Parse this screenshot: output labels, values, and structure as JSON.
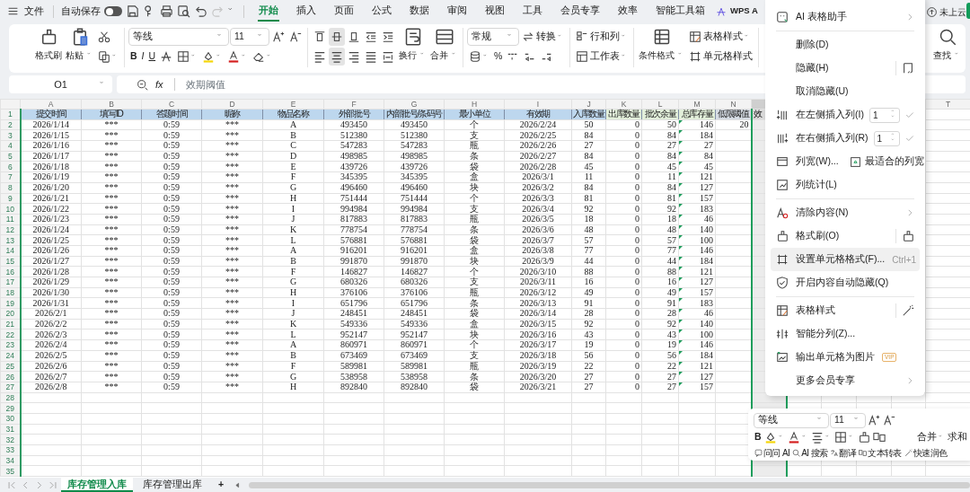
{
  "file_menu": "文件",
  "autosave": {
    "label": "自动保存",
    "on": false
  },
  "redo": {
    "disabled": true
  },
  "tabs": [
    {
      "label": "开始",
      "selected": true
    },
    {
      "label": "插入",
      "selected": false
    },
    {
      "label": "页面",
      "selected": false
    },
    {
      "label": "公式",
      "selected": false
    },
    {
      "label": "数据",
      "selected": false
    },
    {
      "label": "审阅",
      "selected": false
    },
    {
      "label": "视图",
      "selected": false
    },
    {
      "label": "工具",
      "selected": false
    },
    {
      "label": "会员专享",
      "selected": false
    },
    {
      "label": "效率",
      "selected": false
    },
    {
      "label": "智能工具箱",
      "selected": false
    }
  ],
  "wps_label": "WPS A",
  "cloud_status": "未上云",
  "ribbon": {
    "format_painter": "格式刷",
    "paste": "粘贴",
    "font": "等线",
    "font_size": "11",
    "bold": "B",
    "italic": "I",
    "underline": "U",
    "wrap": "换行",
    "merge": "合并",
    "number_format": "常规",
    "convert": "转换",
    "percent": "%",
    "rows_cols": "行和列",
    "worksheet": "工作表",
    "conditional": "条件格式",
    "table_style": "表格样式",
    "cell_style": "单元格样式",
    "find": "查找",
    "valign": [
      {
        "selected": false
      },
      {
        "selected": true
      },
      {
        "selected": false
      }
    ],
    "halign": [
      {
        "selected": false
      },
      {
        "selected": true
      },
      {
        "selected": false
      },
      {
        "selected": false
      }
    ]
  },
  "name_box": "O1",
  "fx": "fx",
  "formula": "效期阈值",
  "columns": [
    {
      "letter": "A",
      "selected": false
    },
    {
      "letter": "B",
      "selected": false
    },
    {
      "letter": "C",
      "selected": false
    },
    {
      "letter": "D",
      "selected": false
    },
    {
      "letter": "E",
      "selected": false
    },
    {
      "letter": "F",
      "selected": false
    },
    {
      "letter": "G",
      "selected": false
    },
    {
      "letter": "H",
      "selected": false
    },
    {
      "letter": "I",
      "selected": false
    },
    {
      "letter": "J",
      "selected": false
    },
    {
      "letter": "K",
      "selected": false
    },
    {
      "letter": "L",
      "selected": false
    },
    {
      "letter": "M",
      "selected": false
    },
    {
      "letter": "N",
      "selected": false
    },
    {
      "selected": true
    },
    {
      "letter": "T",
      "selected": false
    }
  ],
  "row_numbers": [
    "1",
    "2",
    "3",
    "4",
    "5",
    "6",
    "7",
    "8",
    "9",
    "10",
    "11",
    "12",
    "13",
    "14",
    "15",
    "16",
    "17",
    "18",
    "19",
    "20",
    "21",
    "22",
    "23",
    "24",
    "25",
    "26",
    "27",
    "28",
    "29",
    "30",
    "31",
    "32",
    "33",
    "34",
    "35"
  ],
  "header_row": [
    {
      "text": "提交时间",
      "color": "#bdd7ee"
    },
    {
      "text": "填写ID",
      "color": "#bdd7ee"
    },
    {
      "text": "答题时间",
      "color": "#bdd7ee"
    },
    {
      "text": "昵称",
      "color": "#bdd7ee"
    },
    {
      "text": "物品名称",
      "color": "#bdd7ee"
    },
    {
      "text": "外部批号",
      "color": "#bdd7ee"
    },
    {
      "text": "内部批号/条码号",
      "color": "#bdd7ee"
    },
    {
      "text": "最小单位",
      "color": "#bdd7ee"
    },
    {
      "text": "有效期",
      "color": "#bdd7ee"
    },
    {
      "text": "入库数量",
      "color": "#bdd7ee"
    },
    {
      "text": "出库数量",
      "color": "#e2efda"
    },
    {
      "text": "批次余量",
      "color": "#e2efda"
    },
    {
      "text": "总库存量",
      "color": "#e2efda"
    },
    {
      "text": "低限阈值",
      "color": "#d6dce4"
    },
    {
      "text": "效",
      "color": "#d9d9d9"
    }
  ],
  "rows": [
    {
      "cells": [
        "2026/1/14",
        "***",
        "0:59",
        "***",
        "A",
        "493450",
        "493450",
        "个",
        "2026/2/24",
        "50",
        "0",
        "50",
        "146",
        "20"
      ],
      "flagged": true
    },
    {
      "cells": [
        "2026/1/15",
        "***",
        "0:59",
        "***",
        "B",
        "512380",
        "512380",
        "支",
        "2026/2/25",
        "84",
        "0",
        "84",
        "184"
      ],
      "flagged": true
    },
    {
      "cells": [
        "2026/1/16",
        "***",
        "0:59",
        "***",
        "C",
        "547283",
        "547283",
        "瓶",
        "2026/2/26",
        "27",
        "0",
        "27",
        "27"
      ],
      "flagged": true
    },
    {
      "cells": [
        "2026/1/17",
        "***",
        "0:59",
        "***",
        "D",
        "498985",
        "498985",
        "条",
        "2026/2/27",
        "84",
        "0",
        "84",
        "84"
      ],
      "flagged": true
    },
    {
      "cells": [
        "2026/1/18",
        "***",
        "0:59",
        "***",
        "E",
        "439726",
        "439726",
        "袋",
        "2026/2/28",
        "45",
        "0",
        "45",
        "45"
      ],
      "flagged": true
    },
    {
      "cells": [
        "2026/1/19",
        "***",
        "0:59",
        "***",
        "F",
        "345395",
        "345395",
        "盒",
        "2026/3/1",
        "11",
        "0",
        "11",
        "121"
      ],
      "flagged": true
    },
    {
      "cells": [
        "2026/1/20",
        "***",
        "0:59",
        "***",
        "G",
        "496460",
        "496460",
        "块",
        "2026/3/2",
        "84",
        "0",
        "84",
        "127"
      ],
      "flagged": true
    },
    {
      "cells": [
        "2026/1/21",
        "***",
        "0:59",
        "***",
        "H",
        "751444",
        "751444",
        "个",
        "2026/3/3",
        "81",
        "0",
        "81",
        "157"
      ],
      "flagged": true
    },
    {
      "cells": [
        "2026/1/22",
        "***",
        "0:59",
        "***",
        "I",
        "994984",
        "994984",
        "支",
        "2026/3/4",
        "92",
        "0",
        "92",
        "183"
      ],
      "flagged": true
    },
    {
      "cells": [
        "2026/1/23",
        "***",
        "0:59",
        "***",
        "J",
        "817883",
        "817883",
        "瓶",
        "2026/3/5",
        "18",
        "0",
        "18",
        "46"
      ],
      "flagged": true
    },
    {
      "cells": [
        "2026/1/24",
        "***",
        "0:59",
        "***",
        "K",
        "778754",
        "778754",
        "条",
        "2026/3/6",
        "48",
        "0",
        "48",
        "140"
      ],
      "flagged": true
    },
    {
      "cells": [
        "2026/1/25",
        "***",
        "0:59",
        "***",
        "L",
        "576881",
        "576881",
        "袋",
        "2026/3/7",
        "57",
        "0",
        "57",
        "100"
      ],
      "flagged": true
    },
    {
      "cells": [
        "2026/1/26",
        "***",
        "0:59",
        "***",
        "A",
        "916201",
        "916201",
        "盒",
        "2026/3/8",
        "77",
        "0",
        "77",
        "146"
      ],
      "flagged": true
    },
    {
      "cells": [
        "2026/1/27",
        "***",
        "0:59",
        "***",
        "B",
        "991870",
        "991870",
        "块",
        "2026/3/9",
        "44",
        "0",
        "44",
        "184"
      ],
      "flagged": true
    },
    {
      "cells": [
        "2026/1/28",
        "***",
        "0:59",
        "***",
        "F",
        "146827",
        "146827",
        "个",
        "2026/3/10",
        "88",
        "0",
        "88",
        "121"
      ],
      "flagged": true
    },
    {
      "cells": [
        "2026/1/29",
        "***",
        "0:59",
        "***",
        "G",
        "680326",
        "680326",
        "支",
        "2026/3/11",
        "16",
        "0",
        "16",
        "127"
      ],
      "flagged": true
    },
    {
      "cells": [
        "2026/1/30",
        "***",
        "0:59",
        "***",
        "H",
        "376106",
        "376106",
        "瓶",
        "2026/3/12",
        "49",
        "0",
        "49",
        "157"
      ],
      "flagged": true
    },
    {
      "cells": [
        "2026/1/31",
        "***",
        "0:59",
        "***",
        "I",
        "651796",
        "651796",
        "条",
        "2026/3/13",
        "91",
        "0",
        "91",
        "183"
      ],
      "flagged": true
    },
    {
      "cells": [
        "2026/2/1",
        "***",
        "0:59",
        "***",
        "J",
        "248451",
        "248451",
        "袋",
        "2026/3/14",
        "28",
        "0",
        "28",
        "46"
      ],
      "flagged": true
    },
    {
      "cells": [
        "2026/2/2",
        "***",
        "0:59",
        "***",
        "K",
        "549336",
        "549336",
        "盒",
        "2026/3/15",
        "92",
        "0",
        "92",
        "140"
      ],
      "flagged": true
    },
    {
      "cells": [
        "2026/2/3",
        "***",
        "0:59",
        "***",
        "L",
        "952147",
        "952147",
        "块",
        "2026/3/16",
        "43",
        "0",
        "43",
        "100"
      ],
      "flagged": true
    },
    {
      "cells": [
        "2026/2/4",
        "***",
        "0:59",
        "***",
        "A",
        "860971",
        "860971",
        "个",
        "2026/3/17",
        "19",
        "0",
        "19",
        "146"
      ],
      "flagged": true
    },
    {
      "cells": [
        "2026/2/5",
        "***",
        "0:59",
        "***",
        "B",
        "673469",
        "673469",
        "支",
        "2026/3/18",
        "56",
        "0",
        "56",
        "184"
      ],
      "flagged": true
    },
    {
      "cells": [
        "2026/2/6",
        "***",
        "0:59",
        "***",
        "F",
        "589981",
        "589981",
        "瓶",
        "2026/3/19",
        "22",
        "0",
        "22",
        "121"
      ],
      "flagged": true
    },
    {
      "cells": [
        "2026/2/7",
        "***",
        "0:59",
        "***",
        "G",
        "538958",
        "538958",
        "条",
        "2026/3/20",
        "27",
        "0",
        "27",
        "127"
      ],
      "flagged": true
    },
    {
      "cells": [
        "2026/2/8",
        "***",
        "0:59",
        "***",
        "H",
        "892840",
        "892840",
        "袋",
        "2026/3/21",
        "27",
        "0",
        "27",
        "157"
      ],
      "flagged": true
    }
  ],
  "context_menu": [
    {
      "kind": "item",
      "label": "AI 表格助手",
      "submenu": true,
      "highlighted": false
    },
    {
      "kind": "divider"
    },
    {
      "kind": "item",
      "label": "删除(D)",
      "highlighted": false
    },
    {
      "kind": "item",
      "label": "隐藏(H)",
      "side_icon": true,
      "highlighted": false
    },
    {
      "kind": "item",
      "label": "取消隐藏(U)",
      "highlighted": false
    },
    {
      "kind": "item",
      "label": "在左侧插入列(I)",
      "spin_value": "1",
      "highlighted": false
    },
    {
      "kind": "item",
      "label": "在右侧插入列(R)",
      "spin_value": "1",
      "highlighted": false
    },
    {
      "kind": "item",
      "label": "列宽(W)...",
      "side_label": "最适合的列宽",
      "highlighted": false
    },
    {
      "kind": "item",
      "label": "列统计(L)",
      "highlighted": false
    },
    {
      "kind": "divider"
    },
    {
      "kind": "item",
      "label": "清除内容(N)",
      "submenu": true,
      "highlighted": false
    },
    {
      "kind": "item",
      "label": "格式刷(O)",
      "side_icon": true,
      "highlighted": false
    },
    {
      "kind": "item",
      "label": "设置单元格格式(F)...",
      "shortcut": "Ctrl+1",
      "highlighted": true
    },
    {
      "kind": "item",
      "label": "开启内容自动隐藏(Q)",
      "highlighted": false
    },
    {
      "kind": "divider"
    },
    {
      "kind": "item",
      "label": "表格样式",
      "side_icon": true,
      "highlighted": false
    },
    {
      "kind": "item",
      "label": "智能分列(Z)...",
      "highlighted": false
    },
    {
      "kind": "item",
      "label": "输出单元格为图片",
      "badge": "VIP",
      "highlighted": false
    },
    {
      "kind": "item",
      "label": "更多会员专享",
      "submenu": true,
      "highlighted": false
    }
  ],
  "mini_toolbar": {
    "font": "等线",
    "font_size": "11",
    "bold": "B",
    "merge": "合并",
    "sum": "求和",
    "actions": [
      "问问 AI",
      "AI 搜索",
      "翻译",
      "文本转表",
      "快速润色"
    ]
  },
  "sheet_tabs": [
    {
      "label": "库存管理入库",
      "selected": true
    },
    {
      "label": "库存管理出库",
      "selected": false
    }
  ],
  "add_sheet": "+"
}
